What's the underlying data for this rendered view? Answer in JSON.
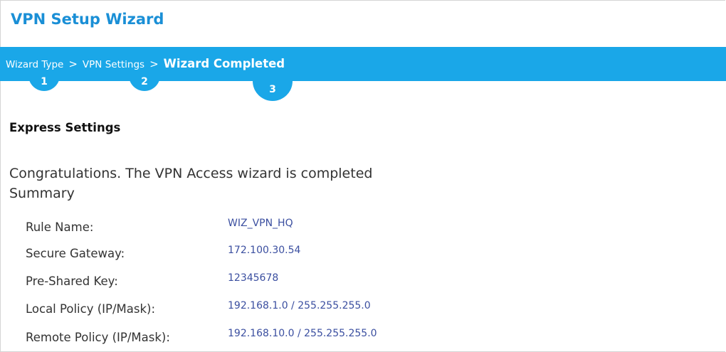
{
  "window": {
    "title": "VPN Setup Wizard"
  },
  "steps": {
    "items": [
      {
        "label": "Wizard Type",
        "number": "1"
      },
      {
        "label": "VPN Settings",
        "number": "2"
      },
      {
        "label": "Wizard Completed",
        "number": "3"
      }
    ],
    "separator": ">"
  },
  "section_title": "Express Settings",
  "message": "Congratulations. The VPN Access wizard is completed",
  "summary_heading": "Summary",
  "summary": [
    {
      "label": "Rule Name:",
      "value": "WIZ_VPN_HQ"
    },
    {
      "label": "Secure Gateway:",
      "value": "172.100.30.54"
    },
    {
      "label": "Pre-Shared Key:",
      "value": "12345678"
    },
    {
      "label": "Local Policy (IP/Mask):",
      "value": "192.168.1.0 / 255.255.255.0"
    },
    {
      "label": "Remote Policy (IP/Mask):",
      "value": "192.168.10.0 / 255.255.255.0"
    }
  ],
  "colors": {
    "accent": "#1aa7e8",
    "title": "#1a8fd6",
    "value_text": "#3b4fa0"
  }
}
